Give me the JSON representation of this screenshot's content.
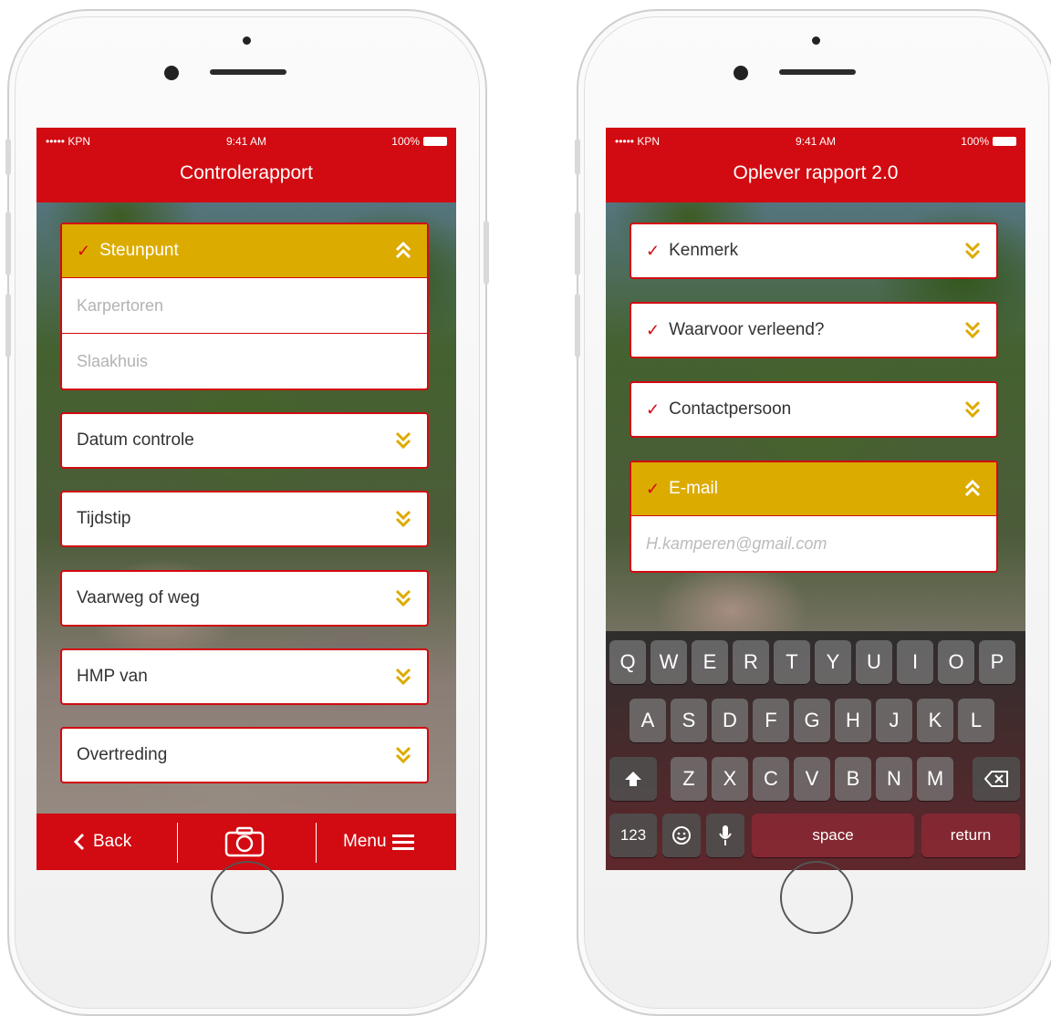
{
  "colors": {
    "brand_red": "#d20a11",
    "accent_yellow": "#dcab00"
  },
  "status_bar": {
    "carrier": "••••• KPN",
    "time": "9:41 AM",
    "battery": "100%"
  },
  "left_phone": {
    "title": "Controlerapport",
    "open_section": {
      "label": "Steunpunt",
      "completed": true,
      "icon": "chevron-up-double-icon",
      "options": [
        "Karpertoren",
        "Slaakhuis"
      ]
    },
    "sections": [
      {
        "label": "Datum controle",
        "icon": "chevron-down-double-icon"
      },
      {
        "label": "Tijdstip",
        "icon": "chevron-down-double-icon"
      },
      {
        "label": "Vaarweg of weg",
        "icon": "chevron-down-double-icon"
      },
      {
        "label": "HMP van",
        "icon": "chevron-down-double-icon"
      },
      {
        "label": "Overtreding",
        "icon": "chevron-down-double-icon"
      }
    ],
    "bottom_bar": {
      "back_label": "Back",
      "camera_icon": "camera-icon",
      "menu_label": "Menu"
    }
  },
  "right_phone": {
    "title": "Oplever rapport 2.0",
    "sections": [
      {
        "label": "Kenmerk",
        "completed": true,
        "icon": "chevron-down-double-icon"
      },
      {
        "label": "Waarvoor verleend?",
        "completed": true,
        "icon": "chevron-down-double-icon"
      },
      {
        "label": "Contactpersoon",
        "completed": true,
        "icon": "chevron-down-double-icon"
      }
    ],
    "open_section": {
      "label": "E-mail",
      "completed": true,
      "icon": "chevron-up-double-icon",
      "input_placeholder": "H.kamperen@gmail.com"
    },
    "keyboard": {
      "row1": [
        "Q",
        "W",
        "E",
        "R",
        "T",
        "Y",
        "U",
        "I",
        "O",
        "P"
      ],
      "row2": [
        "A",
        "S",
        "D",
        "F",
        "G",
        "H",
        "J",
        "K",
        "L"
      ],
      "row3": [
        "Z",
        "X",
        "C",
        "V",
        "B",
        "N",
        "M"
      ],
      "numbers_label": "123",
      "space_label": "space",
      "return_label": "return"
    }
  }
}
